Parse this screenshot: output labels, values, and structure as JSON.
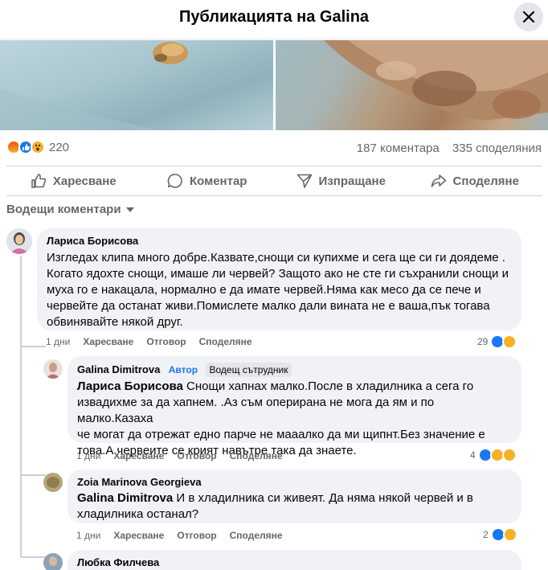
{
  "header": {
    "title": "Публикацията на Galina"
  },
  "post": {
    "reaction_count": "220",
    "comments": "187 коментара",
    "shares": "335 споделяния",
    "reaction_icons": [
      "angry-icon",
      "like-icon",
      "wow-icon"
    ]
  },
  "actions": [
    {
      "label": "Харесване",
      "icon": "thumbs-up-icon"
    },
    {
      "label": "Коментар",
      "icon": "comment-icon"
    },
    {
      "label": "Изпращане",
      "icon": "send-icon"
    },
    {
      "label": "Споделяне",
      "icon": "share-icon"
    }
  ],
  "sort": {
    "label": "Водещи коментари"
  },
  "comments": [
    {
      "name": "Лариса Борисова",
      "lines": [
        "Изгледах клипа много добре.Казвате,снощи си купихме и сега ще си ги доядеме .",
        "Когато ядохте снощи, имаше ли червей? Защото ако не сте ги съхранили снощи и",
        "муха го е накацала, нормално е да имате червей.Няма как месо да се пече и",
        "червейте да останат живи.Помислете малко дали вината не е ваша,пък тогава",
        "обвинявайте някой друг."
      ],
      "age": "1 дни",
      "like": "Харесване",
      "reply": "Отговор",
      "share": "Споделяне",
      "reactions": "29"
    },
    {
      "name": "Galina Dimitrova",
      "author_badge": "Автор",
      "top_badge": "Водещ сътрудник",
      "mention": "Лариса Борисова",
      "first_line_rest": " Снощи хапнах малко.После в хладилника а сега го",
      "lines": [
        "извадихме за да хапнем. .Аз съм оперирана не мога да ям и по малко.Казаха",
        "че могат да отрежат едно парче не мааалко да ми щипнт.Без значение е",
        "това.А червеите се крият навътре така да знаете."
      ],
      "age": "1 дни",
      "like": "Харесване",
      "reply": "Отговор",
      "share": "Споделяне",
      "reactions": "4"
    },
    {
      "name": "Zoia Marinova Georgieva",
      "mention": "Galina Dimitrova",
      "first_line_rest": " И в хладилника си живеят. Да няма някой червей и в",
      "lines": [
        "хладилника останал?"
      ],
      "age": "1 дни",
      "like": "Харесване",
      "reply": "Отговор",
      "share": "Споделяне",
      "reactions": "2"
    },
    {
      "name": "Любка Филчева"
    }
  ]
}
